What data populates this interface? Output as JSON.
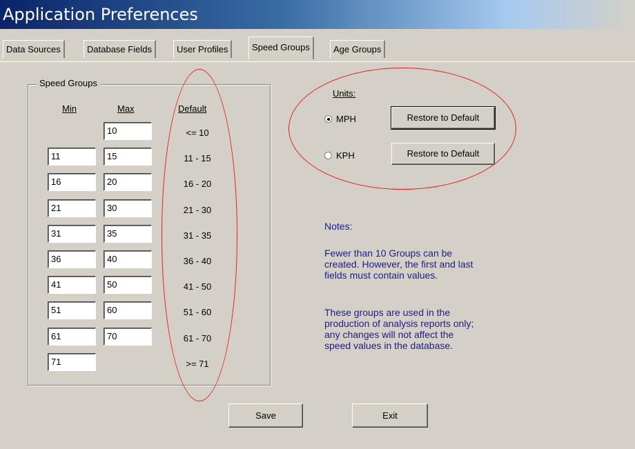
{
  "window": {
    "title": "Application Preferences"
  },
  "tabs": [
    {
      "label": "Data Sources"
    },
    {
      "label": "Database Fields"
    },
    {
      "label": "User Profiles"
    },
    {
      "label": "Speed Groups",
      "active": true
    },
    {
      "label": "Age Groups"
    }
  ],
  "speed_groups": {
    "label": "Speed Groups",
    "headers": {
      "min": "Min",
      "max": "Max",
      "default": "Default"
    },
    "rows": [
      {
        "min": "",
        "max": "10",
        "default": "<= 10"
      },
      {
        "min": "11",
        "max": "15",
        "default": "11 - 15"
      },
      {
        "min": "16",
        "max": "20",
        "default": "16 - 20"
      },
      {
        "min": "21",
        "max": "30",
        "default": "21 - 30"
      },
      {
        "min": "31",
        "max": "35",
        "default": "31 - 35"
      },
      {
        "min": "36",
        "max": "40",
        "default": "36 - 40"
      },
      {
        "min": "41",
        "max": "50",
        "default": "41 - 50"
      },
      {
        "min": "51",
        "max": "60",
        "default": "51 - 60"
      },
      {
        "min": "61",
        "max": "70",
        "default": "61 - 70"
      },
      {
        "min": "71",
        "max": "",
        "default": ">= 71"
      }
    ]
  },
  "units": {
    "label": "Units:",
    "options": [
      {
        "label": "MPH",
        "selected": true,
        "button": "Restore to Default"
      },
      {
        "label": "KPH",
        "selected": false,
        "button": "Restore to Default"
      }
    ]
  },
  "notes": {
    "heading": "Notes:",
    "para1": [
      "Fewer than 10 Groups can be",
      "created. However, the first and last",
      "fields must contain values."
    ],
    "para2": [
      "These groups are used in the",
      "production of analysis reports only;",
      "any changes will not affect the",
      "speed values in the database."
    ]
  },
  "buttons": {
    "save": "Save",
    "exit": "Exit"
  },
  "colors": {
    "annotation": "#e02020",
    "notes_text": "#1c1c8c",
    "dialog_bg": "#d4d0c8"
  }
}
